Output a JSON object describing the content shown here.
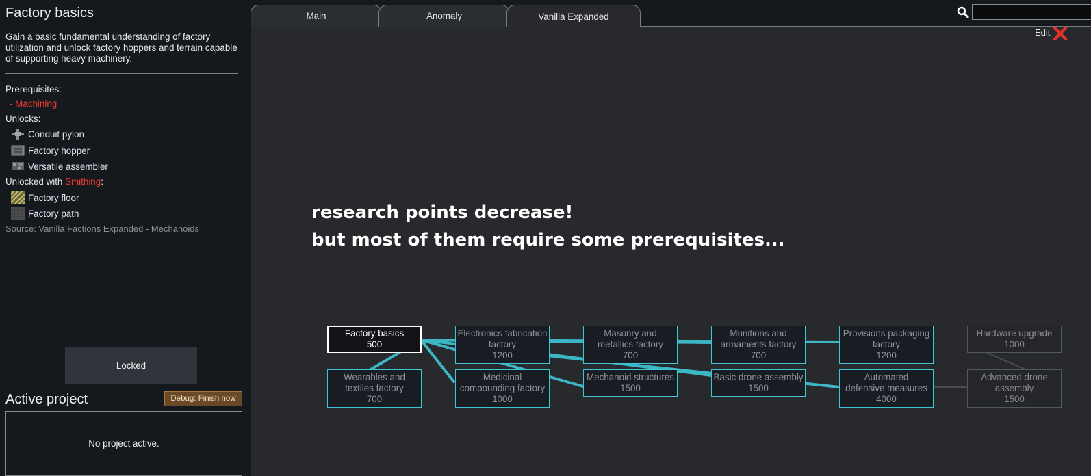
{
  "detail": {
    "title": "Factory basics",
    "description": "Gain a basic fundamental understanding of factory utilization and unlock factory hoppers and terrain capable of supporting heavy machinery.",
    "prerequisites_label": "Prerequisites:",
    "prerequisite_item": "- Machining",
    "unlocks_label": "Unlocks:",
    "unlocks": [
      "Conduit pylon",
      "Factory hopper",
      "Versatile assembler"
    ],
    "unlocked_with_prefix": "Unlocked with ",
    "unlocked_with_research": "Smithing",
    "unlocked_with_suffix": ":",
    "unlocked_with": [
      "Factory floor",
      "Factory path"
    ],
    "source": "Source:  Vanilla Factions Expanded - Mechanoids",
    "locked_button": "Locked"
  },
  "active_project": {
    "title": "Active project",
    "debug_button": "Debug: Finish now",
    "empty_text": "No project active."
  },
  "tabs": [
    "Main",
    "Anomaly",
    "Vanilla Expanded"
  ],
  "active_tab": "Vanilla Expanded",
  "search": {
    "value": "",
    "placeholder": ""
  },
  "edit_label": "Edit",
  "overlay": {
    "line1": "research points decrease!",
    "line2": "but most of them require some prerequisites..."
  },
  "nodes": [
    {
      "label": "Factory basics",
      "cost": "500"
    },
    {
      "label": "Wearables and textiles factory",
      "cost": "700"
    },
    {
      "label": "Electronics fabrication factory",
      "cost": "1200"
    },
    {
      "label": "Medicinal compounding factory",
      "cost": "1000"
    },
    {
      "label": "Masonry and metallics factory",
      "cost": "700"
    },
    {
      "label": "Mechanoid structures",
      "cost": "1500"
    },
    {
      "label": "Munitions and armaments factory",
      "cost": "700"
    },
    {
      "label": "Basic drone assembly",
      "cost": "1500"
    },
    {
      "label": "Provisions packaging factory",
      "cost": "1200"
    },
    {
      "label": "Automated defensive measures",
      "cost": "4000"
    },
    {
      "label": "Hardware upgrade",
      "cost": "1000"
    },
    {
      "label": "Advanced drone assembly",
      "cost": "1500"
    }
  ],
  "colors": {
    "link": "#3fc6d6",
    "prerequisite_missing": "#ee3b32",
    "panel_bg": "#15181c",
    "canvas_bg": "#28292c"
  }
}
